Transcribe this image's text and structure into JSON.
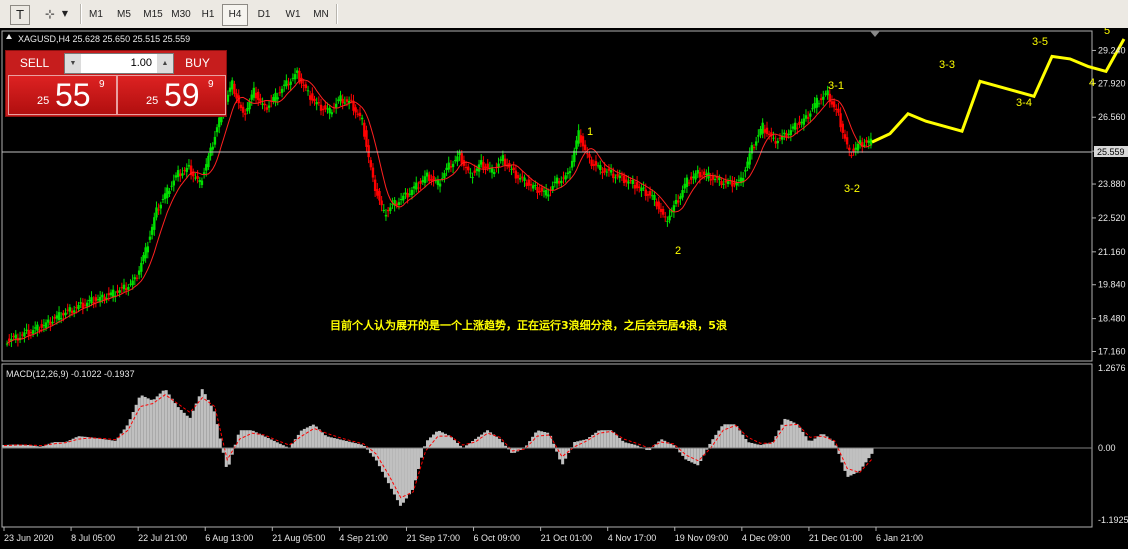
{
  "toolbar": {
    "timeframes": [
      "M1",
      "M5",
      "M15",
      "M30",
      "H1",
      "H4",
      "D1",
      "W1",
      "MN"
    ],
    "active_timeframe": "H4"
  },
  "chart": {
    "symbol_info": "XAGUSD,H4  25.628 25.650 25.515 25.559",
    "current_price": "25.559",
    "macd_info": "MACD(12,26,9) -0.1022 -0.1937",
    "annotation": "目前个人认为展开的是一个上涨趋势，正在运行3浪细分浪，之后会完居4浪，5浪",
    "colors": {
      "up": "#00e000",
      "down": "#ff0000",
      "projection": "#ffff00",
      "background": "#000000",
      "histogram": "#c0c0c0",
      "signal": "#ff0000"
    }
  },
  "trade_panel": {
    "sell_label": "SELL",
    "buy_label": "BUY",
    "lot": "1.00",
    "sell_price": {
      "prefix": "25",
      "big": "55",
      "sup": "9"
    },
    "buy_price": {
      "prefix": "25",
      "big": "59",
      "sup": "9"
    }
  },
  "chart_data": {
    "type": "line",
    "title": "XAGUSD,H4",
    "price_axis": [
      "29.240",
      "27.920",
      "26.560",
      "25.200",
      "23.880",
      "22.520",
      "21.160",
      "19.840",
      "18.480",
      "17.160"
    ],
    "macd_axis": [
      "1.2676",
      "0.00",
      "-1.1925"
    ],
    "time_axis": [
      "23 Jun 2020",
      "8 Jul 05:00",
      "22 Jul 21:00",
      "6 Aug 13:00",
      "21 Aug 05:00",
      "4 Sep 21:00",
      "21 Sep 17:00",
      "6 Oct 09:00",
      "21 Oct 01:00",
      "4 Nov 17:00",
      "19 Nov 09:00",
      "4 Dec 09:00",
      "21 Dec 01:00",
      "6 Jan 21:00"
    ],
    "wave_labels": [
      "1",
      "2",
      "3-1",
      "3-2",
      "3-3",
      "3-4",
      "3-5",
      "4",
      "5"
    ],
    "ylim": [
      17.16,
      29.24
    ],
    "series": [
      {
        "name": "XAGUSD",
        "values": [
          17.6,
          17.7,
          17.9,
          18.1,
          18.3,
          18.6,
          18.8,
          19.0,
          19.2,
          19.3,
          19.5,
          19.7,
          20.0,
          21.2,
          22.8,
          23.6,
          24.3,
          24.5,
          23.9,
          25.2,
          26.8,
          27.9,
          26.6,
          27.6,
          26.9,
          27.4,
          27.9,
          28.3,
          27.5,
          27.0,
          26.8,
          27.3,
          27.1,
          26.4,
          24.0,
          22.7,
          23.1,
          23.4,
          23.8,
          24.2,
          23.9,
          24.6,
          25.0,
          24.2,
          24.7,
          24.4,
          24.9,
          24.3,
          24.0,
          23.7,
          23.5,
          24.0,
          24.2,
          25.9,
          24.8,
          24.5,
          24.3,
          24.1,
          23.9,
          23.6,
          23.3,
          22.4,
          23.1,
          24.0,
          24.3,
          24.2,
          24.0,
          23.9,
          24.0,
          25.3,
          26.2,
          25.6,
          25.8,
          26.2,
          26.5,
          27.2,
          27.5,
          26.6,
          25.1,
          25.5,
          25.56
        ]
      },
      {
        "name": "Projection",
        "values": [
          25.56,
          25.9,
          26.7,
          26.4,
          26.2,
          26.0,
          28.0,
          27.8,
          27.6,
          27.4,
          29.0,
          28.9,
          28.6,
          28.4,
          29.7
        ]
      },
      {
        "name": "MACD",
        "values": [
          0.05,
          0.06,
          0.05,
          0.02,
          0.1,
          0.1,
          0.2,
          0.18,
          0.15,
          0.12,
          0.4,
          0.9,
          0.8,
          1.0,
          0.7,
          0.5,
          1.0,
          0.6,
          -0.4,
          0.3,
          0.3,
          0.2,
          0.1,
          0.0,
          0.3,
          0.4,
          0.2,
          0.15,
          0.1,
          0.05,
          -0.2,
          -0.6,
          -1.0,
          -0.7,
          0.1,
          0.3,
          0.2,
          0.0,
          0.15,
          0.3,
          0.15,
          -0.1,
          0.0,
          0.3,
          0.25,
          -0.3,
          0.1,
          0.15,
          0.3,
          0.3,
          0.1,
          0.05,
          -0.05,
          0.15,
          0.05,
          -0.2,
          -0.3,
          0.1,
          0.4,
          0.4,
          0.1,
          0.05,
          0.1,
          0.5,
          0.4,
          0.1,
          0.25,
          0.1,
          -0.5,
          -0.4,
          -0.1
        ]
      },
      {
        "name": "Signal",
        "values": [
          0.04,
          0.05,
          0.05,
          0.04,
          0.07,
          0.09,
          0.15,
          0.17,
          0.16,
          0.14,
          0.3,
          0.7,
          0.75,
          0.9,
          0.75,
          0.6,
          0.85,
          0.7,
          -0.2,
          0.15,
          0.25,
          0.22,
          0.13,
          0.05,
          0.2,
          0.33,
          0.25,
          0.18,
          0.12,
          0.07,
          -0.1,
          -0.45,
          -0.85,
          -0.75,
          -0.05,
          0.2,
          0.2,
          0.05,
          0.1,
          0.25,
          0.18,
          -0.05,
          -0.02,
          0.2,
          0.22,
          -0.15,
          0.02,
          0.12,
          0.25,
          0.28,
          0.15,
          0.08,
          0.0,
          0.1,
          0.07,
          -0.12,
          -0.22,
          0.0,
          0.3,
          0.38,
          0.18,
          0.08,
          0.08,
          0.38,
          0.4,
          0.18,
          0.2,
          0.12,
          -0.35,
          -0.42,
          -0.19
        ]
      }
    ]
  }
}
